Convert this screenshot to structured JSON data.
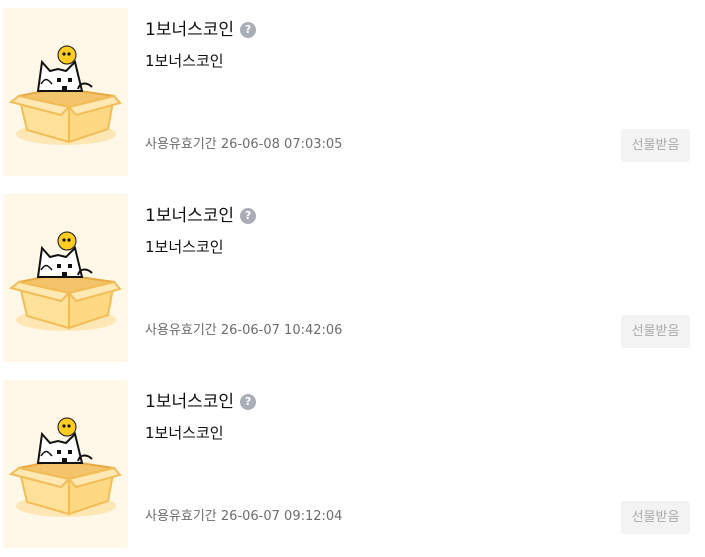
{
  "items": [
    {
      "title": "1보너스코인",
      "help_icon": "?",
      "subtitle": "1보너스코인",
      "expiry_label": "사용유효기간",
      "expiry_date": "26-06-08 07:03:05",
      "button_label": "선물받음",
      "button_state": "disabled"
    },
    {
      "title": "1보너스코인",
      "help_icon": "?",
      "subtitle": "1보너스코인",
      "expiry_label": "사용유효기간",
      "expiry_date": "26-06-07 10:42:06",
      "button_label": "선물받음",
      "button_state": "disabled"
    },
    {
      "title": "1보너스코인",
      "help_icon": "?",
      "subtitle": "1보너스코인",
      "expiry_label": "사용유효기간",
      "expiry_date": "26-06-07 09:12:04",
      "button_label": "선물받음",
      "button_state": "disabled"
    }
  ],
  "icons": {
    "thumbnail": "cat-in-box-with-coin-icon",
    "help": "question-mark-icon"
  },
  "colors": {
    "thumbnail_bg": "#fff8e8",
    "box": "#ffe19a",
    "box_outline": "#f2bd57",
    "coin": "#ffcc21",
    "help_icon_bg": "#a9adb6",
    "button_bg": "#f3f3f3",
    "button_text": "#aaaaaa",
    "meta_text": "#6d6d6d"
  }
}
